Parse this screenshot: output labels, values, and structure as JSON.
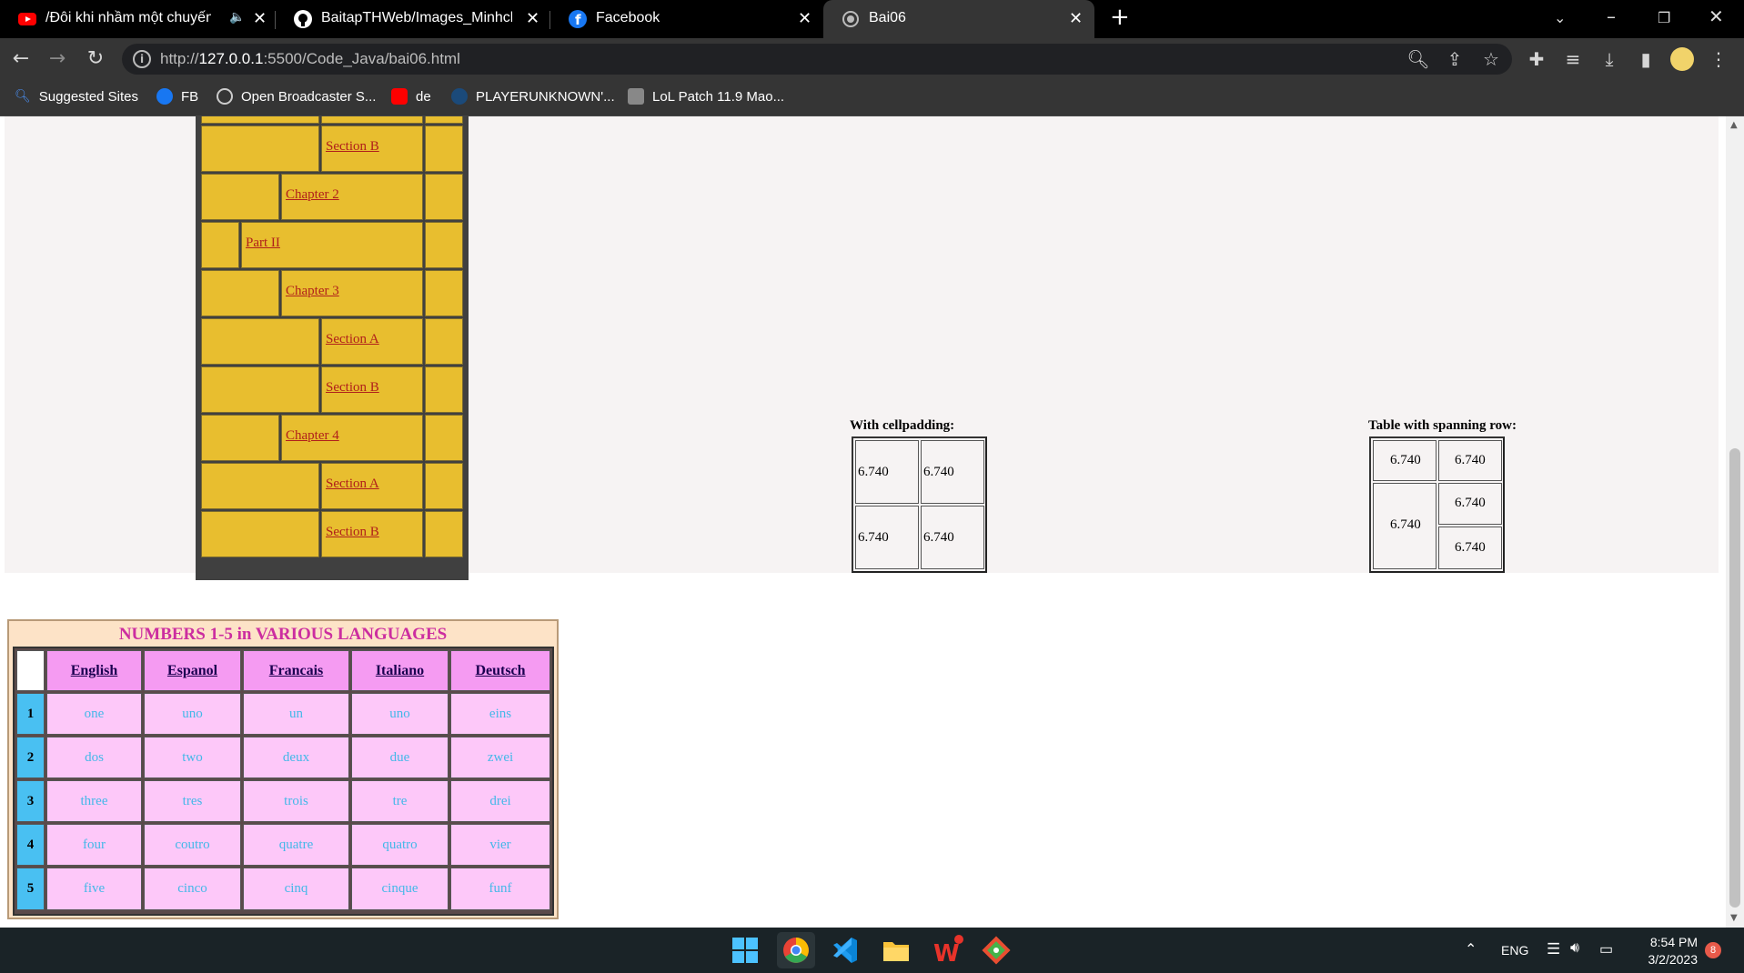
{
  "browser": {
    "tabs": [
      {
        "title": "/Đôi khi nhầm một chuyến xe",
        "favicon": "youtube-icon",
        "audio": true
      },
      {
        "title": "BaitapTHWeb/Images_Minhchung",
        "favicon": "github-icon"
      },
      {
        "title": "Facebook",
        "favicon": "facebook-icon"
      },
      {
        "title": "Bai06",
        "favicon": "globe-icon",
        "active": true
      }
    ],
    "new_tab_label": "+",
    "url_prefix": "http://",
    "url_host": "127.0.0.1",
    "url_rest": ":5500/Code_Java/bai06.html",
    "bookmarks": [
      {
        "label": "Suggested Sites",
        "icon": "search-icon"
      },
      {
        "label": "FB",
        "icon": "facebook-icon"
      },
      {
        "label": "Open Broadcaster S...",
        "icon": "obs-icon"
      },
      {
        "label": "de",
        "icon": "youtube-icon"
      },
      {
        "label": "PLAYERUNKNOWN'...",
        "icon": "steam-icon"
      },
      {
        "label": "LoL Patch 11.9 Mao...",
        "icon": "lol-icon"
      }
    ]
  },
  "page": {
    "toc_links": [
      "Section B",
      "Chapter 2",
      "Part II",
      "Chapter 3",
      "Section A",
      "Section B",
      "Chapter 4",
      "Section A",
      "Section B"
    ],
    "cellpadding_caption": "With cellpadding:",
    "cellpadding_values": [
      "6.740",
      "6.740",
      "6.740",
      "6.740"
    ],
    "spanning_caption": "Table with spanning row:",
    "spanning_values": [
      "6.740",
      "6.740",
      "6.740",
      "6.740",
      "6.740"
    ],
    "languages": {
      "title": "NUMBERS 1-5 in VARIOUS LANGUAGES",
      "headers": [
        "English",
        "Espanol",
        "Francais",
        "Italiano",
        "Deutsch"
      ],
      "rows": [
        {
          "num": "1",
          "values": [
            "one",
            "uno",
            "un",
            "uno",
            "eins"
          ]
        },
        {
          "num": "2",
          "values": [
            "dos",
            "two",
            "deux",
            "due",
            "zwei"
          ]
        },
        {
          "num": "3",
          "values": [
            "three",
            "tres",
            "trois",
            "tre",
            "drei"
          ]
        },
        {
          "num": "4",
          "values": [
            "four",
            "coutro",
            "quatre",
            "quatro",
            "vier"
          ]
        },
        {
          "num": "5",
          "values": [
            "five",
            "cinco",
            "cinq",
            "cinque",
            "funf"
          ]
        }
      ]
    }
  },
  "taskbar": {
    "language": "ENG",
    "time": "8:54 PM",
    "date": "3/2/2023",
    "notification_count": "8"
  }
}
